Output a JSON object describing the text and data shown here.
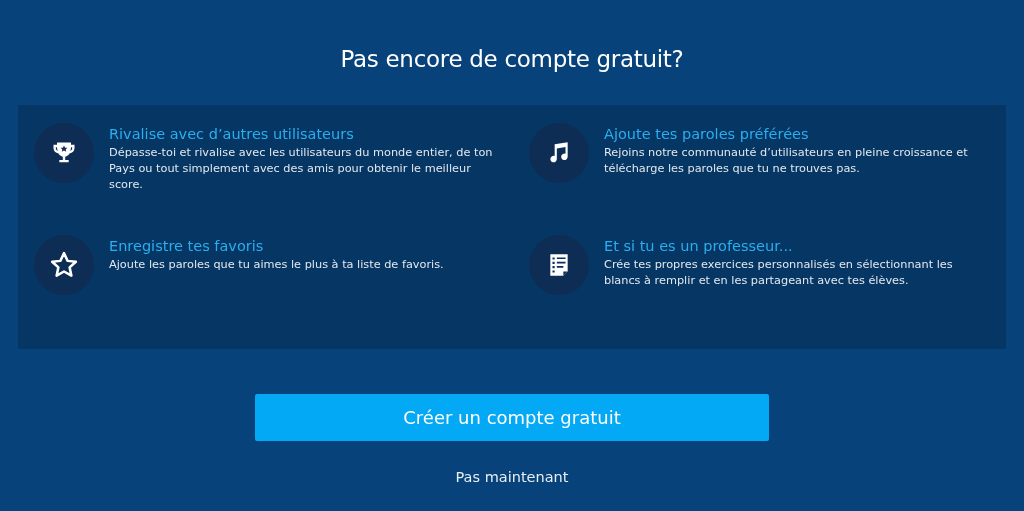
{
  "heading": "Pas encore de compte gratuit?",
  "features": [
    {
      "kind": "trophy",
      "title": "Rivalise avec d’autres utilisateurs",
      "text": "Dépasse-toi et rivalise avec les utilisateurs du monde entier, de ton Pays ou tout simplement avec des amis pour obtenir le meilleur score."
    },
    {
      "kind": "music",
      "title": "Ajoute tes paroles préférées",
      "text": "Rejoins notre communauté d’utilisateurs en pleine croissance et télécharge les paroles que tu ne trouves pas."
    },
    {
      "kind": "star",
      "title": "Enregistre tes favoris",
      "text": "Ajoute les paroles que tu aimes le plus à ta liste de favoris."
    },
    {
      "kind": "document",
      "title": "Et si tu es un professeur...",
      "text": "Crée tes propres exercices personnalisés en sélectionnant les blancs à remplir et en les partageant avec tes élèves."
    }
  ],
  "primary_button": "Créer un compte gratuit",
  "secondary_link": "Pas maintenant"
}
